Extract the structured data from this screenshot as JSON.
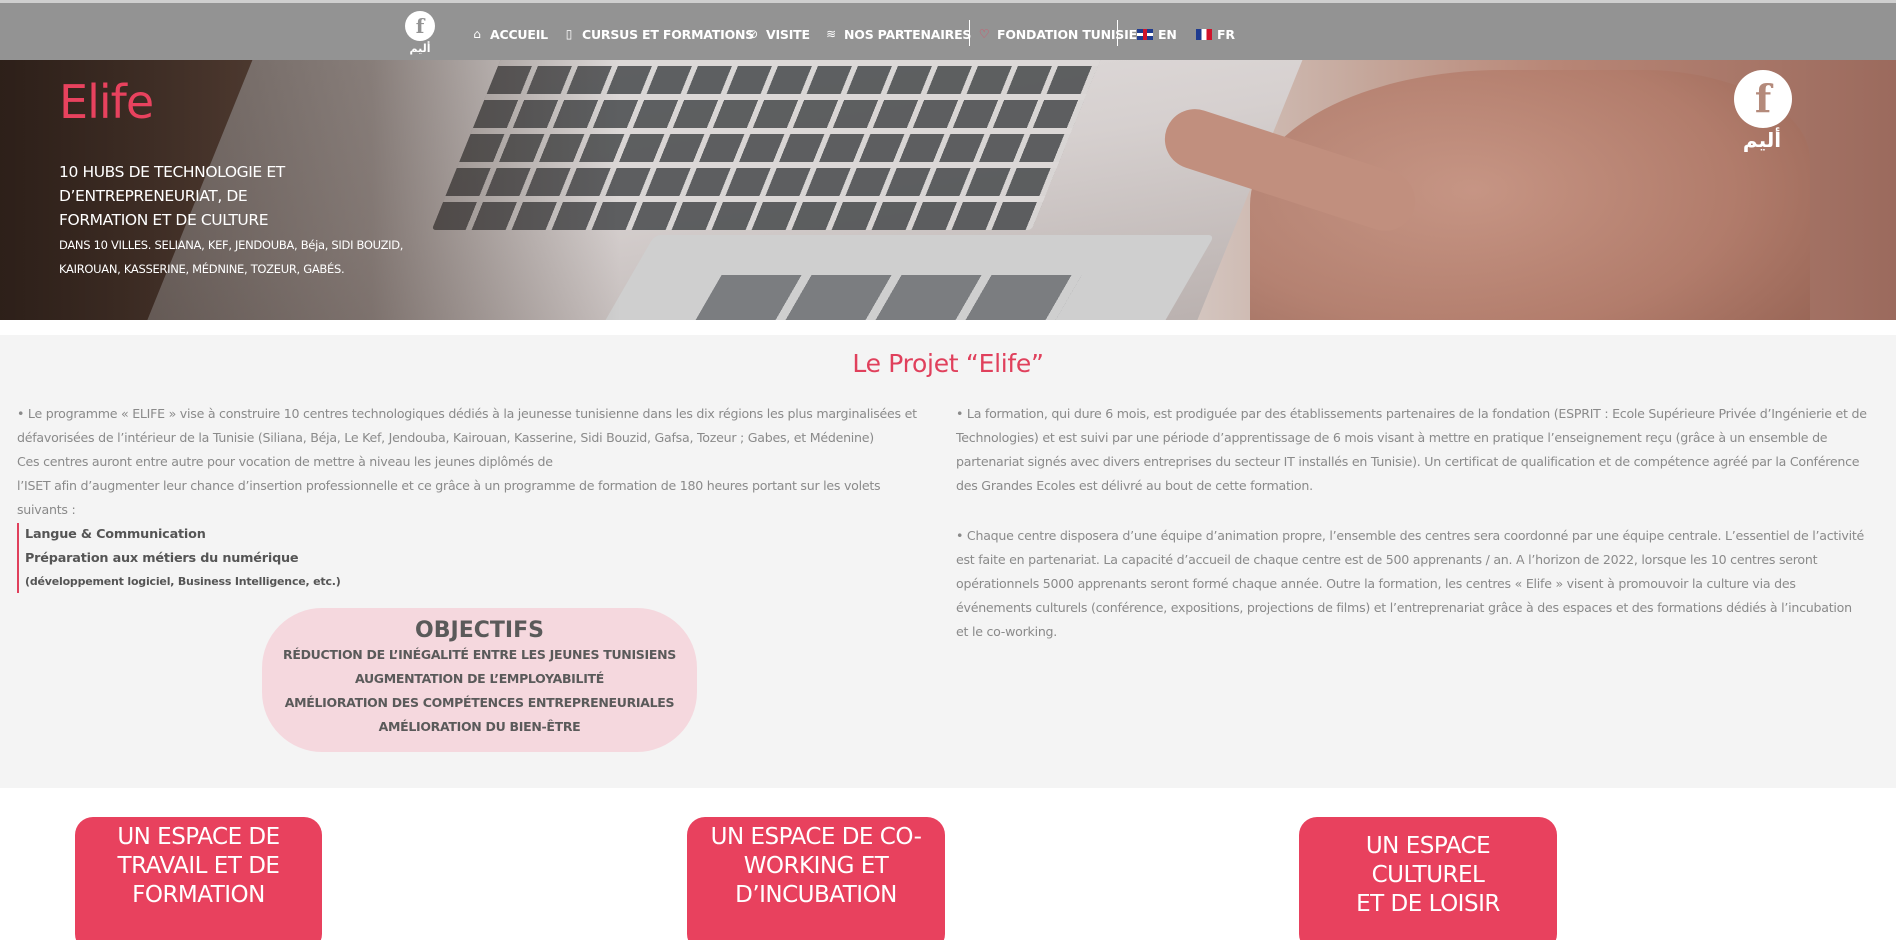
{
  "nav": {
    "logo_letter": "f",
    "logo_arabic": "أليم",
    "items": [
      {
        "label": "ACCUEIL",
        "icon": "home-icon",
        "glyph": "⌂"
      },
      {
        "label": "CURSUS ET FORMATIONS",
        "icon": "clipboard-icon",
        "glyph": "▯"
      },
      {
        "label": "VISITE",
        "icon": "compass-icon",
        "glyph": "⊘"
      },
      {
        "label": "NOS PARTENAIRES",
        "icon": "handshake-icon",
        "glyph": "≋"
      },
      {
        "label": "FONDATION TUNISIE",
        "icon": "heart-icon",
        "glyph": "♡"
      }
    ],
    "languages": [
      {
        "label": "EN",
        "icon": "uk-flag-icon"
      },
      {
        "label": "FR",
        "icon": "france-flag-icon"
      }
    ]
  },
  "hero": {
    "title": "Elife",
    "subtitle_lines": [
      "10 HUBS DE TECHNOLOGIE ET",
      "D’ENTREPRENEURIAT, DE",
      "FORMATION ET DE CULTURE"
    ],
    "cities_lines": [
      "DANS 10 VILLES. SELIANA, KEF, JENDOUBA, Béja, SIDI BOUZID,",
      "KAIROUAN, KASSERINE, MÉDNINE, TOZEUR, GABÉS."
    ],
    "logo_letter": "f",
    "logo_arabic": "أليم"
  },
  "project": {
    "title": "Le Projet “Elife”",
    "left_lines": [
      "• Le programme « ELIFE » vise à construire 10 centres technologiques dédiés à la jeunesse tunisienne dans les dix régions les plus marginalisées et",
      "défavorisées de l’intérieur de la Tunisie (Siliana, Béja, Le Kef, Jendouba, Kairouan, Kasserine, Sidi Bouzid, Gafsa, Tozeur ; Gabes, et Médenine)",
      "Ces centres auront entre autre pour vocation de mettre à niveau les jeunes diplômés de",
      "l’ISET afin d’augmenter leur chance d’insertion professionnelle et ce grâce à un programme de formation de 180 heures portant sur les volets",
      "suivants :"
    ],
    "list": [
      "Langue & Communication",
      "Préparation aux métiers du numérique",
      "(développement logiciel, Business Intelligence, etc.)"
    ],
    "objectifs": {
      "title": "OBJECTIFS",
      "items": [
        "RÉDUCTION DE L’INÉGALITÉ ENTRE LES JEUNES TUNISIENS",
        "AUGMENTATION DE L’EMPLOYABILITÉ",
        "AMÉLIORATION DES COMPÉTENCES ENTREPRENEURIALES",
        "AMÉLIORATION DU BIEN-ÊTRE"
      ]
    },
    "right_para1": [
      "• La formation, qui dure 6 mois, est prodiguée par des établissements partenaires de la fondation (ESPRIT : Ecole Supérieure Privée d’Ingénierie et de",
      "Technologies) et est suivi par une période d’apprentissage de 6 mois visant à mettre en pratique l’enseignement reçu (grâce à un ensemble de",
      "partenariat signés avec divers entreprises du secteur IT installés en Tunisie). Un certificat de qualification et de compétence agréé par la Conférence",
      "des Grandes Ecoles est délivré au bout de cette formation."
    ],
    "right_para2": [
      "• Chaque centre disposera d’une équipe d’animation propre, l’ensemble des centres sera coordonné par une équipe centrale. L’essentiel de l’activité",
      "est faite en partenariat. La capacité d’accueil de chaque centre est de 500 apprenants / an. A l’horizon de 2022, lorsque les 10 centres seront",
      "opérationnels 5000 apprenants seront formé chaque année. Outre la formation, les centres « Elife » visent à promouvoir la culture via des",
      "événements culturels (conférence, expositions, projections de films) et l’entreprenariat grâce à des espaces et des formations dédiés à l’incubation",
      "et le co-working."
    ]
  },
  "cards": [
    {
      "lines": [
        "UN ESPACE DE",
        "TRAVAIL ET DE",
        "FORMATION"
      ]
    },
    {
      "lines": [
        "UN ESPACE DE CO-",
        "WORKING ET",
        "D’INCUBATION"
      ]
    },
    {
      "lines": [
        "UN ESPACE CULTUREL",
        "ET DE LOISIR"
      ]
    }
  ],
  "colors": {
    "accent": "#e8415e",
    "nav_bg": "#939393",
    "section_bg": "#f4f4f4",
    "objectifs_bg": "#f5d8de"
  }
}
